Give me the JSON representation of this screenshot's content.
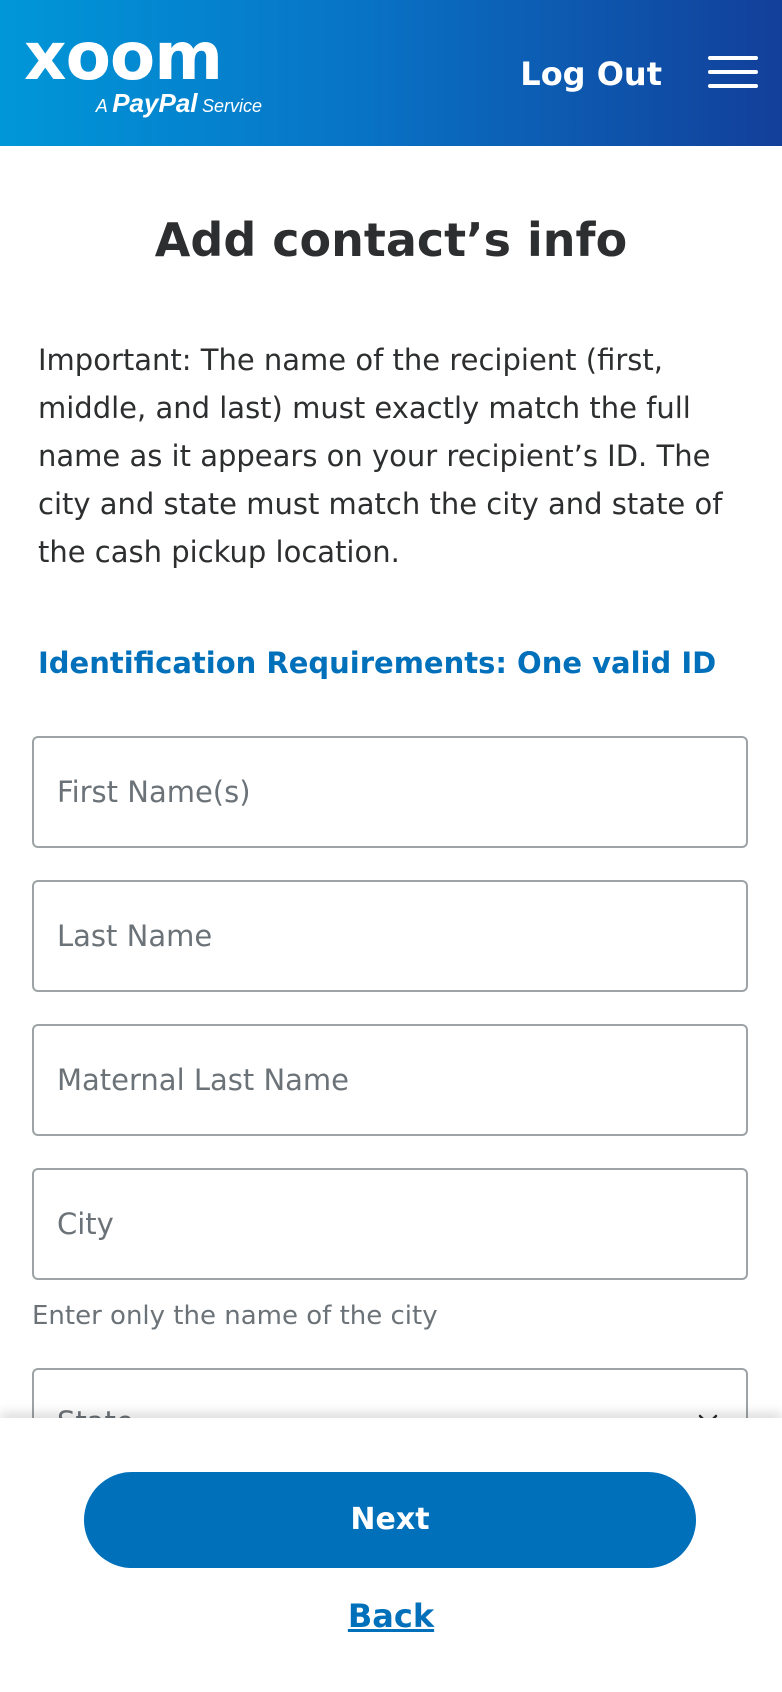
{
  "header": {
    "logo_word": "xoom",
    "logo_sub_prefix": "A",
    "logo_sub_brand": "PayPal",
    "logo_sub_suffix": "Service",
    "logout_label": "Log Out",
    "menu_icon": "hamburger-menu-icon"
  },
  "main": {
    "title": "Add contact’s info",
    "important_text": "Important: The name of the recipient (first, middle, and last) must exactly match the full name as it appears on your recipient’s ID. The city and state must match the city and state of the cash pickup location.",
    "id_requirements_link": "Identification Requirements: One valid ID",
    "fields": {
      "first_name": "First Name(s)",
      "last_name": "Last Name",
      "maternal_last_name": "Maternal Last Name",
      "city": "City",
      "state": "State"
    },
    "city_helper": "Enter only the name of the city"
  },
  "footer": {
    "next_label": "Next",
    "back_label": "Back"
  },
  "colors": {
    "header_gradient_start": "#0097d8",
    "header_gradient_end": "#123f9a",
    "primary": "#0070ba",
    "text": "#2c2e2f",
    "placeholder": "#6c7378",
    "field_border": "#9da3a6"
  }
}
